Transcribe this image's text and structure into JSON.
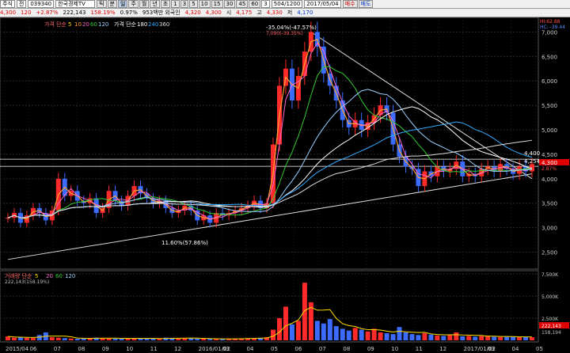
{
  "toolbar": {
    "market_label": "주식",
    "market_sel": "전",
    "code": "039340",
    "name": "한국경제TV",
    "period_tabs": [
      "틱",
      "분",
      "일",
      "주",
      "월",
      "년",
      "초"
    ],
    "interval_buttons": [
      "1",
      "3",
      "5",
      "10",
      "15",
      "30",
      "45",
      "60",
      "3"
    ],
    "count_value": "504/1200",
    "date_value": "2017/05/04",
    "buy_label": "매수",
    "sell_label": "매도"
  },
  "quote": {
    "price": "4,300",
    "change": "120",
    "change_pct": "+2.87%",
    "volume": "222,143",
    "volume_ratio": "158.19%",
    "turnover_pct": "0.97%",
    "value_label": "953백만 외국인",
    "open_label": "시",
    "open": "4,175",
    "high_label": "고",
    "high": "4,330",
    "low_label": "저",
    "low": "4,170",
    "open_price_before": "4,320",
    "open_price_before2": "4,300"
  },
  "legend": {
    "price_legend_title": "가격 단순",
    "price_legend_periods": [
      "5",
      "10",
      "20",
      "60",
      "120"
    ],
    "price_legend2_title": "가격 단순",
    "price_legend2_periods": [
      "180",
      "240",
      "360"
    ],
    "volume_legend_title": "거래량 단순",
    "volume_legend_periods": [
      "5",
      "20",
      "60",
      "120"
    ],
    "volume_last": "222,143(158.19%)"
  },
  "chart_data": {
    "type": "line",
    "ylim": [
      2250,
      7200
    ],
    "price_ticks": [
      2500,
      3000,
      3500,
      4000,
      4500,
      5000,
      5500,
      6000,
      6500,
      7000
    ],
    "x_tick_labels": [
      "2015/04",
      "06",
      "07",
      "08",
      "09",
      "10",
      "11",
      "12",
      "2016/01/02",
      "03",
      "04",
      "05",
      "06",
      "07",
      "08",
      "09",
      "10",
      "11",
      "12",
      "2017/01/02",
      "03",
      "04",
      "05"
    ],
    "annotations": {
      "high_label": "7,090(-39.35%)",
      "high_pct_label": "-35.04%(-47.57%)",
      "low_label": "11.60%(57.86%)",
      "hi_axis_label": "HI:62.88",
      "lo_axis_label": "HC: -39.44",
      "level_4400": "4,400",
      "level_4254": "4,254",
      "current_price_tag": "4,300",
      "current_pct_tag": "2.87%",
      "date_label": "2017/01/02"
    },
    "series": [
      {
        "name": "price",
        "values": [
          3200,
          3300,
          3100,
          3250,
          3400,
          3300,
          3150,
          3350,
          4000,
          3650,
          3750,
          3550,
          3500,
          3600,
          3300,
          3400,
          3750,
          3550,
          3450,
          3650,
          3850,
          3700,
          3600,
          3500,
          3550,
          3400,
          3300,
          3350,
          3450,
          3350,
          3150,
          3250,
          3100,
          3300,
          3250,
          3300,
          3350,
          3400,
          3450,
          3550,
          3400,
          3500,
          4700,
          5900,
          6250,
          5600,
          6100,
          6600,
          7000,
          6700,
          6150,
          5900,
          5600,
          5200,
          5050,
          5200,
          5000,
          5150,
          5300,
          5500,
          5350,
          4700,
          4450,
          4250,
          4200,
          3850,
          4150,
          4050,
          4250,
          4150,
          4200,
          4350,
          4050,
          4100,
          4050,
          4200,
          4250,
          4150,
          4300,
          4200,
          4100,
          4250,
          4150,
          4300
        ]
      },
      {
        "name": "5",
        "values": []
      },
      {
        "name": "10",
        "values": []
      },
      {
        "name": "20",
        "values": []
      },
      {
        "name": "60",
        "values": []
      },
      {
        "name": "120",
        "values": []
      },
      {
        "name": "180",
        "values": []
      },
      {
        "name": "240",
        "values": []
      },
      {
        "name": "360",
        "values": []
      }
    ],
    "volume": {
      "ticks": [
        "7,500K",
        "5,000K",
        "2,500K"
      ],
      "ylim": [
        0,
        7500
      ],
      "values": [
        450,
        300,
        320,
        280,
        260,
        600,
        900,
        350,
        300,
        250,
        200,
        180,
        220,
        260,
        300,
        240,
        220,
        200,
        180,
        260,
        240,
        220,
        200,
        180,
        160,
        300,
        280,
        260,
        240,
        220,
        200,
        180,
        160,
        150,
        170,
        180,
        200,
        220,
        240,
        260,
        280,
        350,
        1200,
        2500,
        3800,
        1800,
        2200,
        6500,
        4300,
        2200,
        1900,
        2400,
        1600,
        1300,
        1100,
        1400,
        1200,
        1000,
        1300,
        900,
        800,
        700,
        1500,
        900,
        700,
        600,
        800,
        650,
        550,
        500,
        600,
        900,
        450,
        500,
        420,
        480,
        520,
        400,
        380,
        420,
        400,
        360,
        380,
        340
      ],
      "last_tag": "222,143",
      "last_tag2": "158,194"
    },
    "colors": {
      "up": "#ff2a2a",
      "down": "#3b6cff",
      "ma5": "#ffe000",
      "ma10": "#ff9a3d",
      "ma20": "#ff66cc",
      "ma60": "#33cc33",
      "ma120": "#9bd0ff",
      "ma180": "#ffffff",
      "ma240": "#33aaff",
      "ma360": "#dcdcdc"
    }
  }
}
